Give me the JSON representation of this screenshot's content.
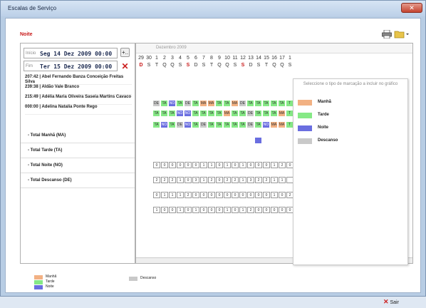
{
  "window": {
    "title": "Escalas de Serviço",
    "close_label": "✕"
  },
  "header": {
    "title": "Noite"
  },
  "filters": {
    "start_label": "Início",
    "start_value": "Seg 14 Dez 2009 00:00",
    "end_label": "Fim",
    "end_value": "Ter 15 Dez 2009 00:00",
    "add_label": "+.."
  },
  "grid": {
    "month_label": "Dezembro 2009",
    "days": [
      "29",
      "30",
      "1",
      "2",
      "3",
      "4",
      "5",
      "6",
      "7",
      "8",
      "9",
      "10",
      "11",
      "12",
      "13",
      "14",
      "15",
      "16",
      "17",
      "1"
    ],
    "weekdays": [
      "D",
      "S",
      "T",
      "Q",
      "Q",
      "S",
      "S",
      "D",
      "S",
      "T",
      "Q",
      "Q",
      "S",
      "S",
      "D",
      "S",
      "T",
      "Q",
      "Q",
      "S"
    ],
    "red_indices": [
      0,
      6,
      13
    ]
  },
  "employees": [
    {
      "name": "207:42 | Abel Fernando Banza Conceição Freitas Silva",
      "shifts": [
        "",
        "",
        "DE",
        "TA",
        "NO",
        "TA",
        "DE",
        "TA",
        "MA",
        "MA",
        "TA",
        "TA",
        "MA",
        "DE",
        "TA",
        "TA",
        "TA",
        "TA",
        "TA",
        "T"
      ]
    },
    {
      "name": "239:38 | Aldão Vale Branco",
      "shifts": [
        "",
        "",
        "TA",
        "TA",
        "TA",
        "NO",
        "NO",
        "TA",
        "TA",
        "TA",
        "TA",
        "MA",
        "TA",
        "TA",
        "DE",
        "TA",
        "TA",
        "TA",
        "MA",
        "T"
      ]
    },
    {
      "name": "215:49 | Adélia Maria Oliveira Saseia Martins Cavaco",
      "shifts": [
        "",
        "",
        "TA",
        "NO",
        "TA",
        "DE",
        "NO",
        "TA",
        "DE",
        "TA",
        "TA",
        "TA",
        "TA",
        "TA",
        "DE",
        "TA",
        "NO",
        "MA",
        "MA",
        "T"
      ]
    },
    {
      "name": "000:00 | Adelina Natalia Ponte Rego",
      "shifts": [
        "",
        "",
        "",
        "",
        "",
        "",
        "",
        "",
        "",
        "",
        "",
        "",
        "",
        "",
        "",
        "NO",
        "",
        "",
        "",
        ""
      ]
    }
  ],
  "totals": [
    {
      "label": "- Total Manhã (MA)",
      "values": [
        "0",
        "0",
        "0",
        "0",
        "0",
        "0",
        "1",
        "1",
        "0",
        "1",
        "0",
        "1",
        "0",
        "0",
        "0",
        "1",
        "2",
        "0"
      ]
    },
    {
      "label": "- Total Tarde (TA)",
      "values": [
        "2",
        "2",
        "2",
        "1",
        "0",
        "3",
        "1",
        "2",
        "0",
        "2",
        "2",
        "1",
        "3",
        "2",
        "2",
        "1",
        "1",
        ""
      ]
    },
    {
      "label": "- Total Noite (NO)",
      "values": [
        "0",
        "1",
        "1",
        "1",
        "2",
        "0",
        "0",
        "0",
        "0",
        "0",
        "0",
        "0",
        "0",
        "0",
        "0",
        "1",
        "0",
        "2"
      ]
    },
    {
      "label": "- Total Descanso (DE)",
      "values": [
        "1",
        "0",
        "0",
        "1",
        "0",
        "1",
        "0",
        "0",
        "0",
        "1",
        "0",
        "1",
        "2",
        "0",
        "0",
        "0",
        "0",
        "0"
      ]
    }
  ],
  "overlay": {
    "prompt": "Seleccione o tipo de marcação a incluir no gráfico",
    "items": [
      {
        "label": "Manhã",
        "color": "#f2b183"
      },
      {
        "label": "Tarde",
        "color": "#86e986"
      },
      {
        "label": "Noite",
        "color": "#6a6ee0"
      },
      {
        "label": "Descanso",
        "color": "#c9c9c9"
      }
    ]
  },
  "legend": {
    "items": [
      {
        "label": "Manhã",
        "color": "#f2b183"
      },
      {
        "label": "Tarde",
        "color": "#86e986"
      },
      {
        "label": "Noite",
        "color": "#6a6ee0"
      }
    ],
    "descanso": {
      "label": "Descanso",
      "color": "#c9c9c9"
    }
  },
  "footer": {
    "exit_label": "Sair"
  }
}
